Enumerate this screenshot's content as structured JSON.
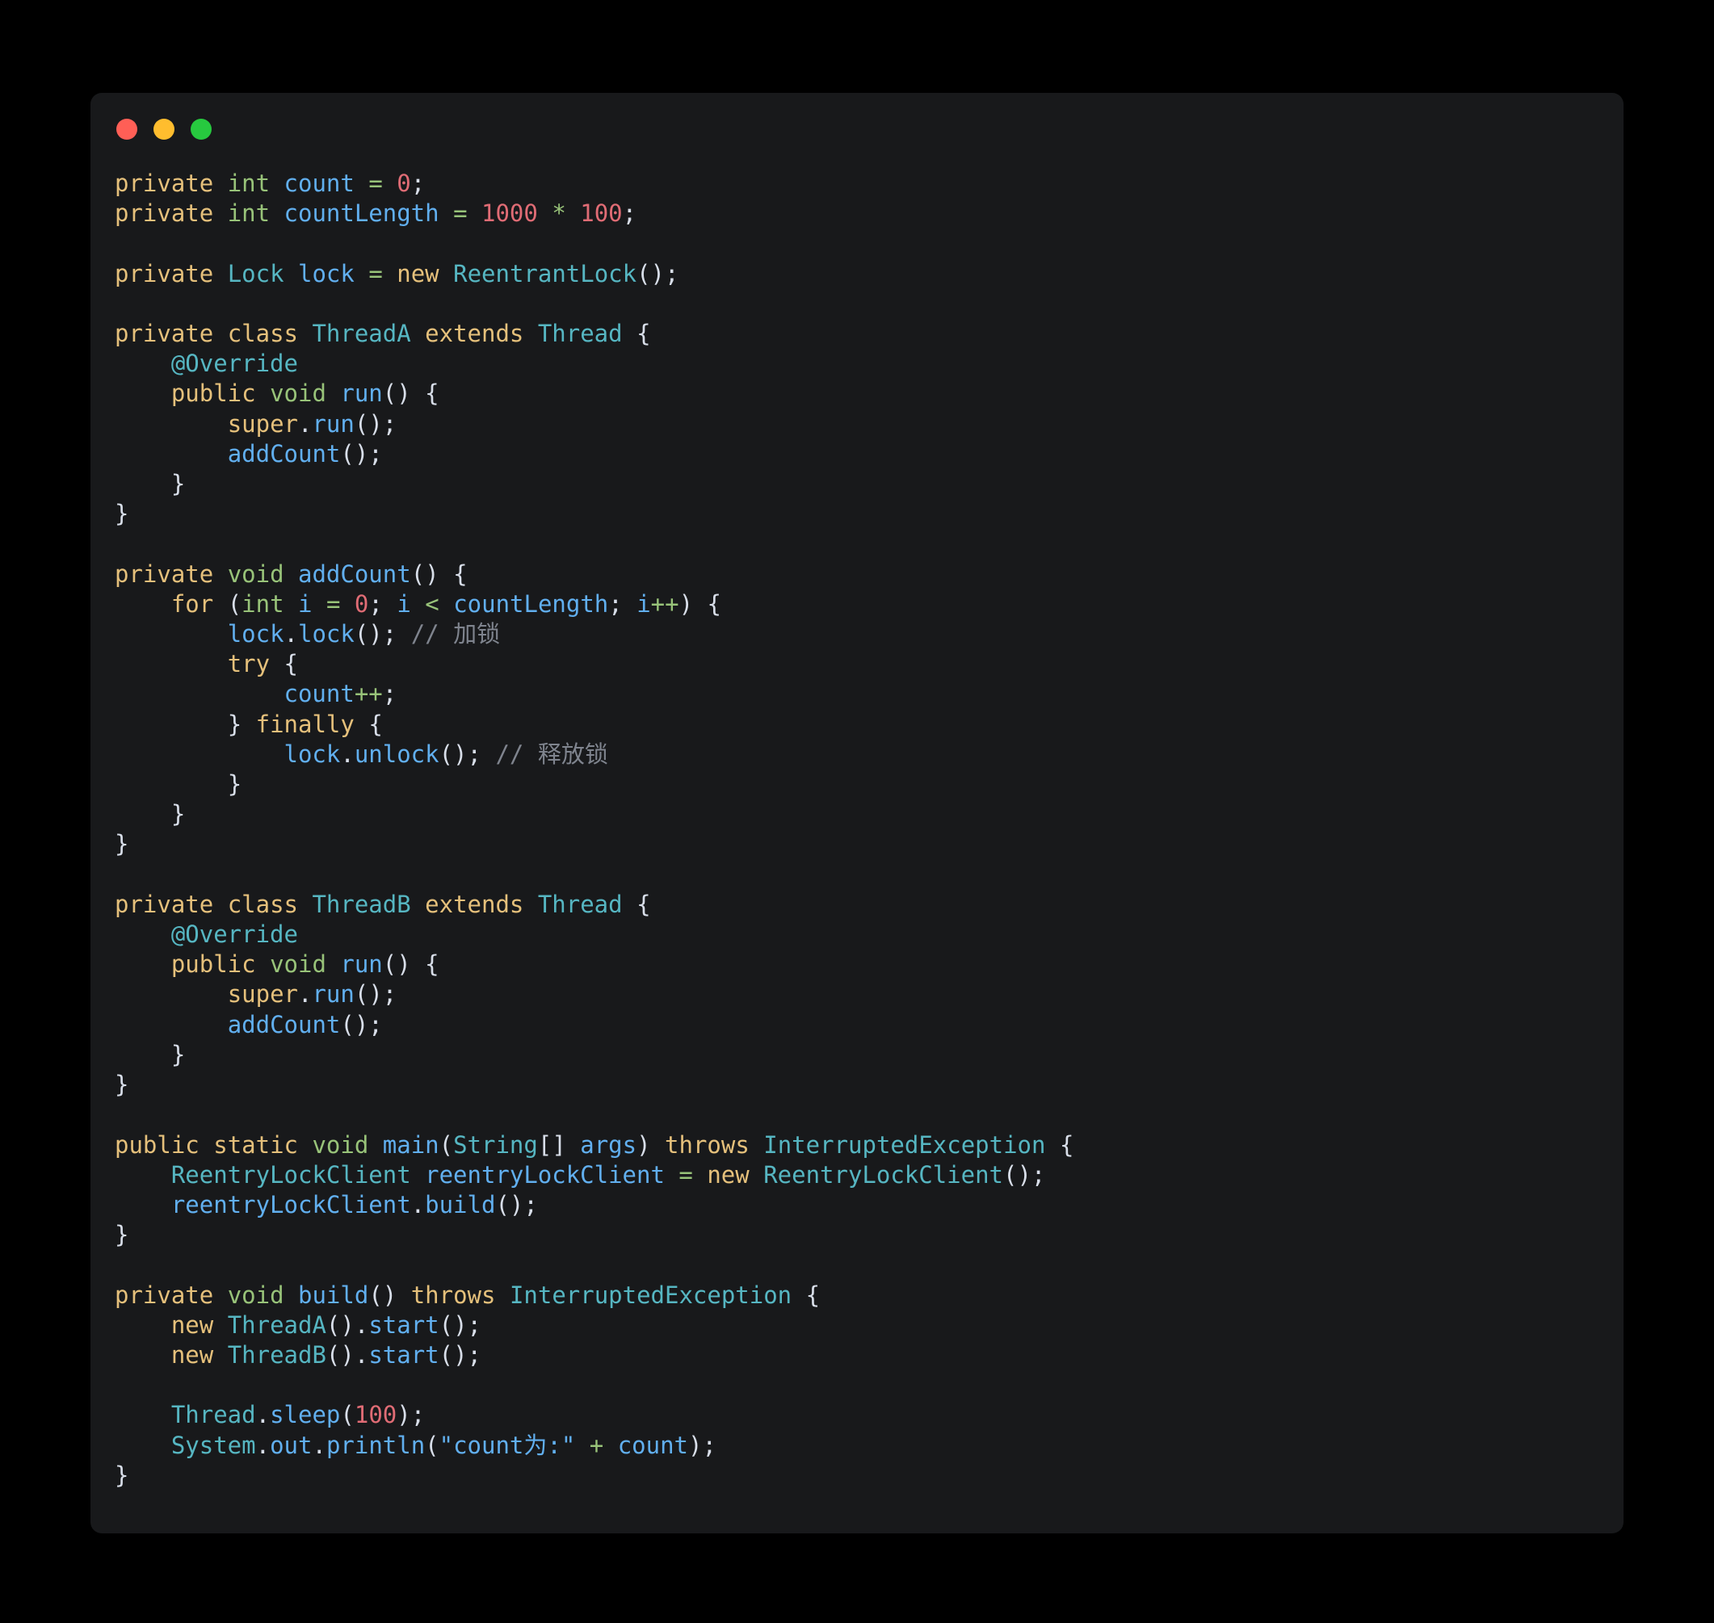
{
  "window": {
    "background_color": "#18191b",
    "page_background_color": "#000000",
    "traffic_lights": [
      {
        "name": "close",
        "color": "#ff5f56"
      },
      {
        "name": "minimize",
        "color": "#ffbd2e"
      },
      {
        "name": "maximize",
        "color": "#27c93f"
      }
    ]
  },
  "theme": {
    "keyword": "#e5c07b",
    "type": "#98c379",
    "class": "#56b6c2",
    "identifier": "#61afef",
    "number": "#e06c75",
    "operator": "#98c379",
    "punctuation": "#d8dee9",
    "string": "#61afef",
    "annotation": "#56b6c2",
    "comment": "#7f848e"
  },
  "code": {
    "language": "java",
    "lines": [
      "private int count = 0;",
      "private int countLength = 1000 * 100;",
      "",
      "private Lock lock = new ReentrantLock();",
      "",
      "private class ThreadA extends Thread {",
      "    @Override",
      "    public void run() {",
      "        super.run();",
      "        addCount();",
      "    }",
      "}",
      "",
      "private void addCount() {",
      "    for (int i = 0; i < countLength; i++) {",
      "        lock.lock(); // 加锁",
      "        try {",
      "            count++;",
      "        } finally {",
      "            lock.unlock(); // 释放锁",
      "        }",
      "    }",
      "}",
      "",
      "private class ThreadB extends Thread {",
      "    @Override",
      "    public void run() {",
      "        super.run();",
      "        addCount();",
      "    }",
      "}",
      "",
      "public static void main(String[] args) throws InterruptedException {",
      "    ReentryLockClient reentryLockClient = new ReentryLockClient();",
      "    reentryLockClient.build();",
      "}",
      "",
      "private void build() throws InterruptedException {",
      "    new ThreadA().start();",
      "    new ThreadB().start();",
      "",
      "    Thread.sleep(100);",
      "    System.out.println(\"count为:\" + count);",
      "}"
    ],
    "comments": [
      "// 加锁",
      "// 释放锁"
    ],
    "string_literals": [
      "\"count为:\""
    ],
    "numbers": [
      "0",
      "1000",
      "100",
      "0",
      "100"
    ],
    "identifiers": [
      "count",
      "countLength",
      "lock",
      "ReentrantLock",
      "ThreadA",
      "ThreadB",
      "Thread",
      "Lock",
      "run",
      "addCount",
      "i",
      "String",
      "args",
      "InterruptedException",
      "main",
      "ReentryLockClient",
      "reentryLockClient",
      "build",
      "start",
      "sleep",
      "System",
      "out",
      "println",
      "super",
      "unlock"
    ]
  }
}
